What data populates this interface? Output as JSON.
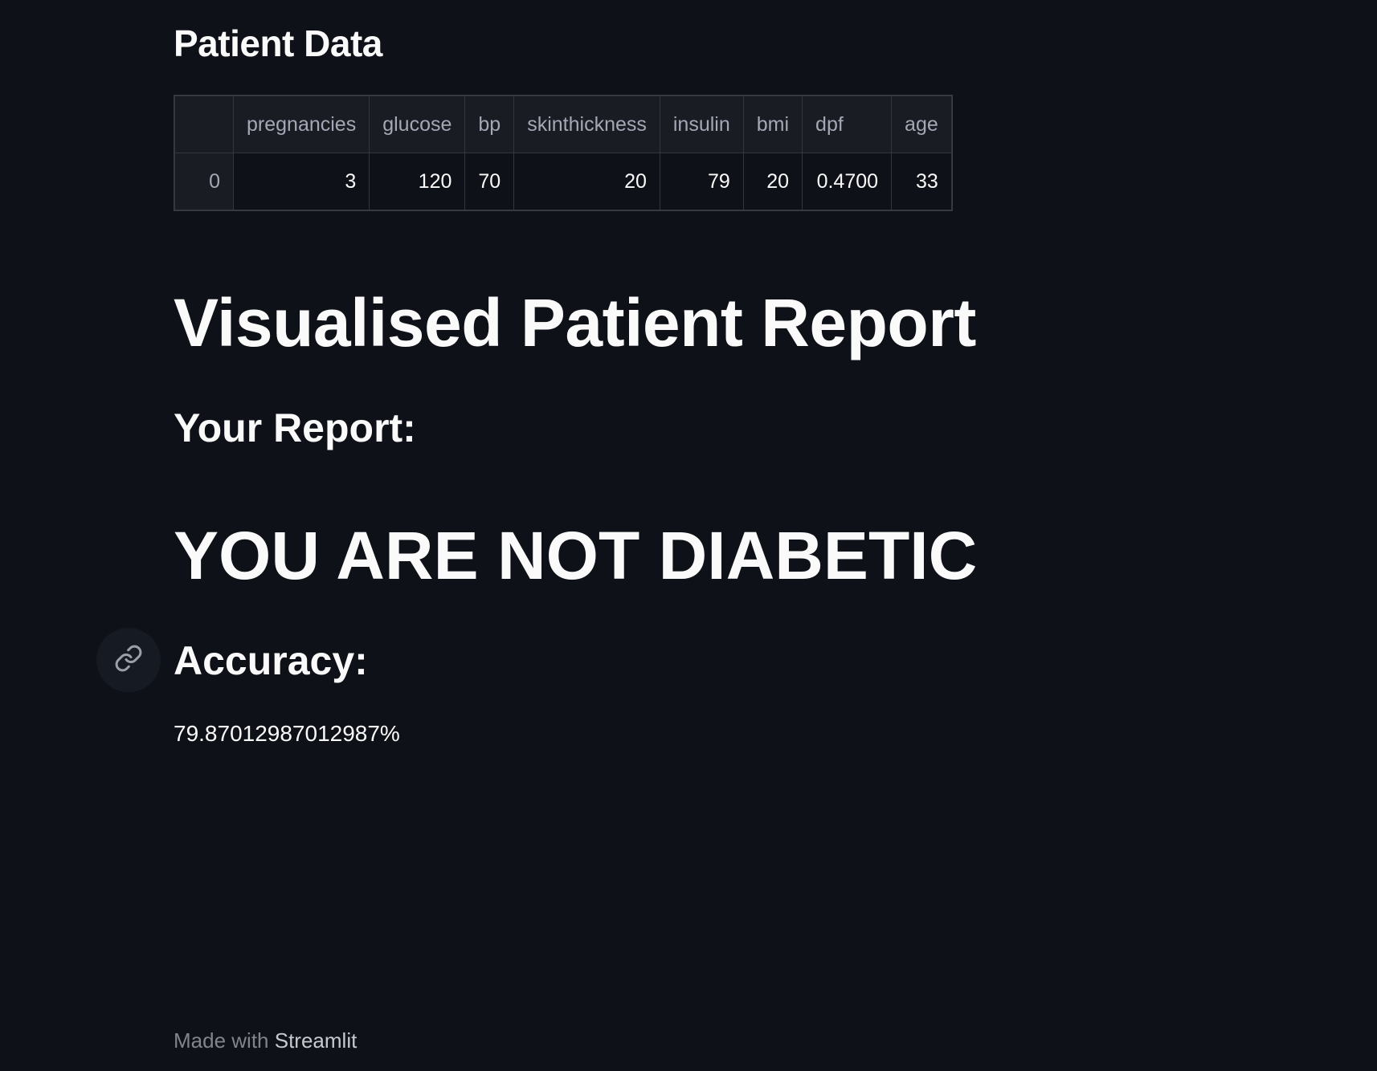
{
  "headings": {
    "patient_data": "Patient Data",
    "visualised_report": "Visualised Patient Report",
    "your_report": "Your Report:",
    "result": "YOU ARE NOT DIABETIC",
    "accuracy": "Accuracy:"
  },
  "table": {
    "columns": [
      "",
      "pregnancies",
      "glucose",
      "bp",
      "skinthickness",
      "insulin",
      "bmi",
      "dpf",
      "age"
    ],
    "rows": [
      [
        "0",
        "3",
        "120",
        "70",
        "20",
        "79",
        "20",
        "0.4700",
        "33"
      ]
    ]
  },
  "accuracy_value": "79.87012987012987%",
  "footer": {
    "prefix": "Made with",
    "brand": "Streamlit"
  },
  "icons": {
    "anchor": "link-icon"
  }
}
